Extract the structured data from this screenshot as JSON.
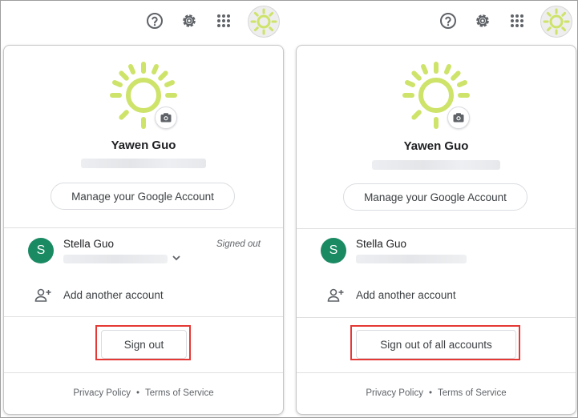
{
  "colors": {
    "accent_green": "#1a8a63",
    "highlight_red": "#e53935",
    "sun_yellow": "#cde36a"
  },
  "icons": {
    "help": "help-circle-icon",
    "settings": "gear-icon",
    "apps": "apps-grid-icon",
    "camera": "camera-icon",
    "add_account": "person-add-icon",
    "expand": "chevron-down-icon"
  },
  "left_panel": {
    "profile_name": "Yawen Guo",
    "manage_button": "Manage your Google Account",
    "other_account": {
      "initial": "S",
      "name": "Stella Guo",
      "status": "Signed out"
    },
    "add_account_label": "Add another account",
    "sign_out_button": "Sign out",
    "footer": {
      "privacy": "Privacy Policy",
      "separator": "•",
      "terms": "Terms of Service"
    }
  },
  "right_panel": {
    "profile_name": "Yawen Guo",
    "manage_button": "Manage your Google Account",
    "other_account": {
      "initial": "S",
      "name": "Stella Guo"
    },
    "add_account_label": "Add another account",
    "sign_out_button": "Sign out of all accounts",
    "footer": {
      "privacy": "Privacy Policy",
      "separator": "•",
      "terms": "Terms of Service"
    }
  }
}
